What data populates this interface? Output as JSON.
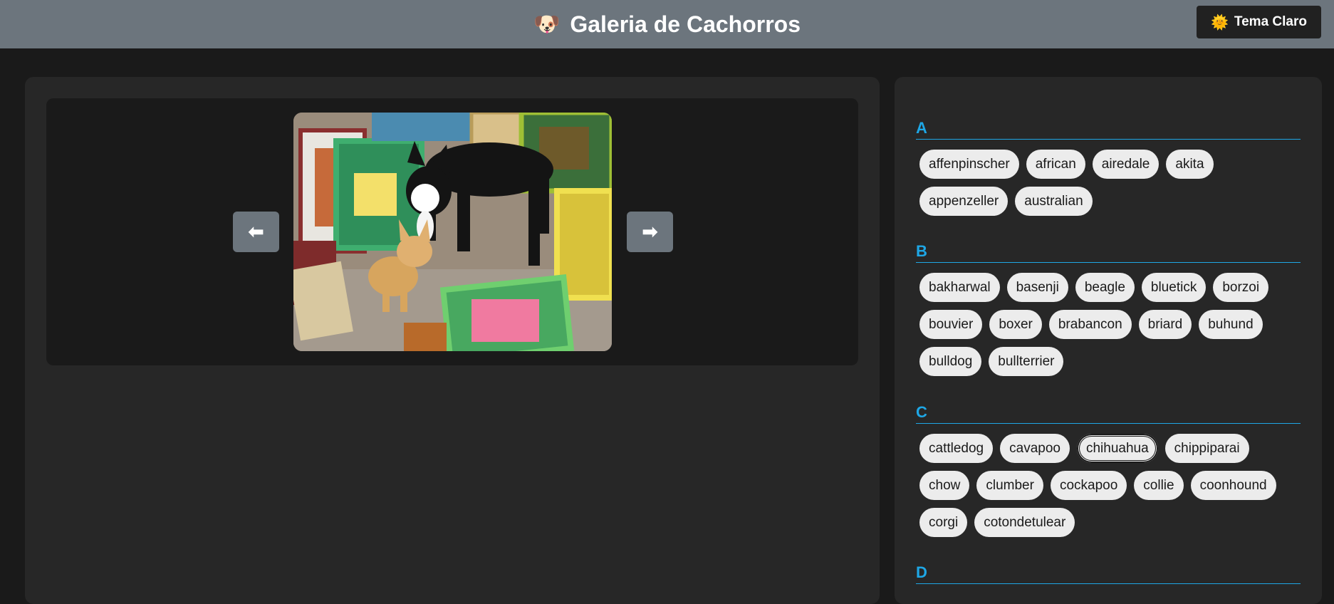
{
  "header": {
    "title": "Galeria de Cachorros",
    "title_icon": "🐶",
    "theme_button_icon": "🌞",
    "theme_button_label": "Tema Claro"
  },
  "carousel": {
    "prev_label": "⬅",
    "next_label": "➡"
  },
  "breeds": {
    "groups": [
      {
        "letter": "A",
        "items": [
          "affenpinscher",
          "african",
          "airedale",
          "akita",
          "appenzeller",
          "australian"
        ]
      },
      {
        "letter": "B",
        "items": [
          "bakharwal",
          "basenji",
          "beagle",
          "bluetick",
          "borzoi",
          "bouvier",
          "boxer",
          "brabancon",
          "briard",
          "buhund",
          "bulldog",
          "bullterrier"
        ]
      },
      {
        "letter": "C",
        "items": [
          "cattledog",
          "cavapoo",
          "chihuahua",
          "chippiparai",
          "chow",
          "clumber",
          "cockapoo",
          "collie",
          "coonhound",
          "corgi",
          "cotondetulear"
        ]
      },
      {
        "letter": "D",
        "items": []
      }
    ],
    "selected": "chihuahua"
  },
  "colors": {
    "header_bg": "#6c757d",
    "page_bg": "#1a1a1a",
    "panel_bg": "#272727",
    "accent": "#1ea7e6",
    "chip_bg": "#ececec"
  }
}
